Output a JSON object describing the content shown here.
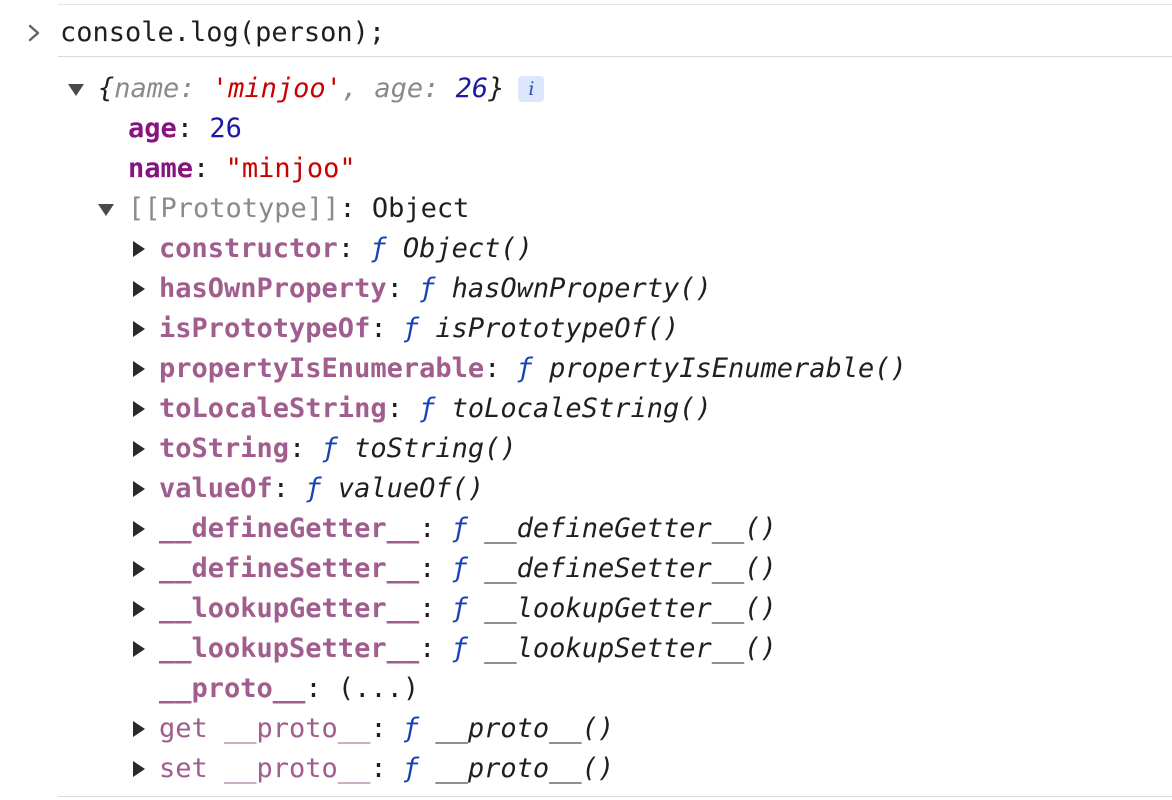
{
  "command": {
    "text": "console.log(person);"
  },
  "preview": {
    "open_brace": "{",
    "k1": "name",
    "sep": ": ",
    "v1": "'minjoo'",
    "comma": ", ",
    "k2": "age",
    "v2": "26",
    "close_brace": "}",
    "info": "i"
  },
  "props": [
    {
      "key": "age",
      "value": "26"
    },
    {
      "key": "name",
      "value": "\"minjoo\""
    }
  ],
  "prototype": {
    "key": "[[Prototype]]",
    "value": "Object"
  },
  "proto_members": [
    {
      "key": "constructor",
      "f": "ƒ",
      "value": "Object()"
    },
    {
      "key": "hasOwnProperty",
      "f": "ƒ",
      "value": "hasOwnProperty()"
    },
    {
      "key": "isPrototypeOf",
      "f": "ƒ",
      "value": "isPrototypeOf()"
    },
    {
      "key": "propertyIsEnumerable",
      "f": "ƒ",
      "value": "propertyIsEnumerable()"
    },
    {
      "key": "toLocaleString",
      "f": "ƒ",
      "value": "toLocaleString()"
    },
    {
      "key": "toString",
      "f": "ƒ",
      "value": "toString()"
    },
    {
      "key": "valueOf",
      "f": "ƒ",
      "value": "valueOf()"
    },
    {
      "key": "__defineGetter__",
      "f": "ƒ",
      "value": "__defineGetter__()"
    },
    {
      "key": "__defineSetter__",
      "f": "ƒ",
      "value": "__defineSetter__()"
    },
    {
      "key": "__lookupGetter__",
      "f": "ƒ",
      "value": "__lookupGetter__()"
    },
    {
      "key": "__lookupSetter__",
      "f": "ƒ",
      "value": "__lookupSetter__()"
    }
  ],
  "proto_accessor": {
    "key": "__proto__",
    "value": "(...)"
  },
  "accessors": [
    {
      "key": "get __proto__",
      "f": "ƒ",
      "value": "__proto__()"
    },
    {
      "key": "set __proto__",
      "f": "ƒ",
      "value": "__proto__()"
    }
  ],
  "colon": ":"
}
